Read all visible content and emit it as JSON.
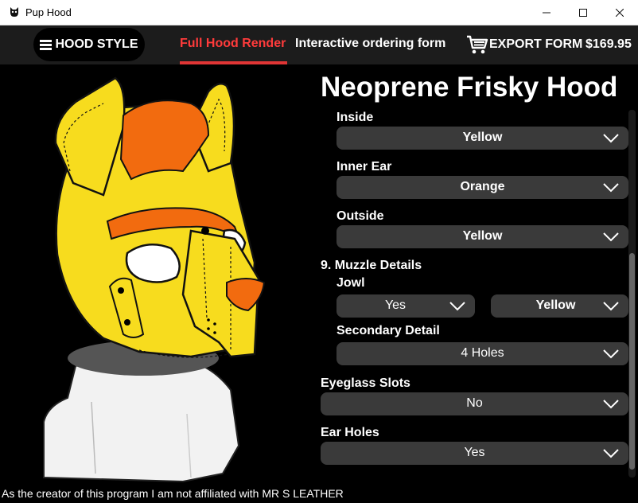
{
  "window": {
    "title": "Pup Hood",
    "icon": "pup-logo-icon",
    "controls": [
      "minimize-icon",
      "maximize-icon",
      "close-icon"
    ]
  },
  "nav": {
    "hood_style_label": "HOOD STYLE",
    "tab_render": "Full Hood Render",
    "tab_form": "Interactive ordering form",
    "export_label": "EXPORT FORM",
    "price": "$169.95",
    "accent": "#e03535"
  },
  "panel": {
    "title": "Neoprene Frisky Hood",
    "fields": {
      "inside": {
        "label": "Inside",
        "value": "Yellow"
      },
      "inner_ear": {
        "label": "Inner Ear",
        "value": "Orange"
      },
      "outside": {
        "label": "Outside",
        "value": "Yellow"
      },
      "section9": "9. Muzzle Details",
      "jowl": {
        "label": "Jowl",
        "value": "Yes",
        "color": "Yellow"
      },
      "secondary": {
        "label": "Secondary Detail",
        "value": "4 Holes"
      },
      "eyeglass": {
        "label": "Eyeglass Slots",
        "value": "No"
      },
      "ear_holes": {
        "label": "Ear Holes",
        "value": "Yes"
      }
    }
  },
  "footer": "As the creator of this program I am not affiliated with MR S LEATHER",
  "colors": {
    "hood_yellow": "#f7dc1e",
    "hood_orange": "#f26b0f",
    "select_bg": "#3a3a3a"
  }
}
